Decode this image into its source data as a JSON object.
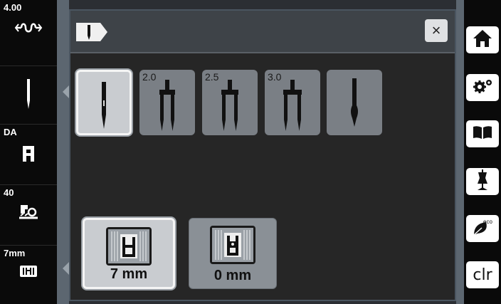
{
  "left_sidebar": {
    "items": [
      {
        "label": "4.00",
        "icon": "stitch-width-icon"
      },
      {
        "label": "",
        "icon": "needle-icon"
      },
      {
        "label": "DA",
        "icon": "presser-foot-icon"
      },
      {
        "label": "40",
        "icon": "presser-foot-pressure-icon"
      },
      {
        "label": "7mm",
        "icon": "stitch-plate-icon"
      }
    ]
  },
  "panel": {
    "header_icon": "needle-tab-icon",
    "close_label": "×",
    "needles": [
      {
        "size": "",
        "type": "single-needle"
      },
      {
        "size": "2.0",
        "type": "twin-needle"
      },
      {
        "size": "2.5",
        "type": "twin-needle"
      },
      {
        "size": "3.0",
        "type": "twin-needle"
      },
      {
        "size": "",
        "type": "wing-needle"
      }
    ],
    "selected_needle": 0,
    "stitch_plates": [
      {
        "label": "7 mm"
      },
      {
        "label": "0 mm"
      }
    ],
    "selected_plate": 0
  },
  "right_sidebar": {
    "buttons": [
      {
        "icon": "home-icon"
      },
      {
        "icon": "settings-icon"
      },
      {
        "icon": "tutorial-book-icon"
      },
      {
        "icon": "dress-form-icon"
      },
      {
        "icon": "eco-mode-icon",
        "text": "eco"
      },
      {
        "icon": "clear-icon",
        "text": "clr"
      }
    ]
  }
}
